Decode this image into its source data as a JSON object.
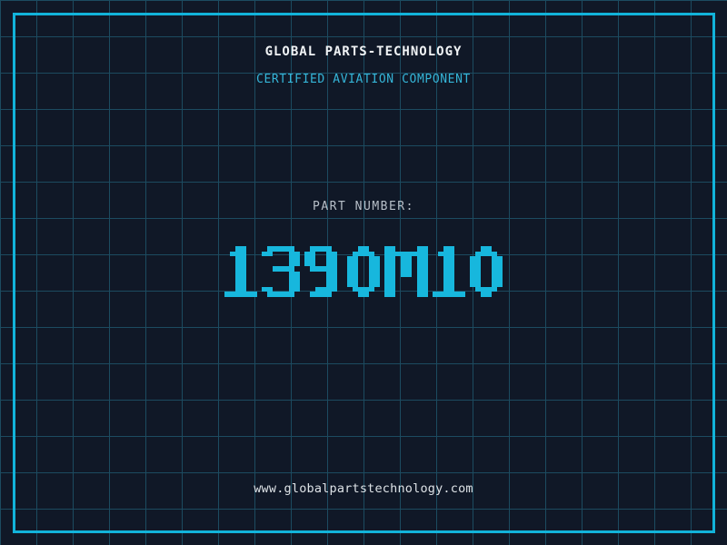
{
  "header": {
    "title": "GLOBAL PARTS-TECHNOLOGY",
    "subtitle": "CERTIFIED AVIATION COMPONENT"
  },
  "part": {
    "label": "PART NUMBER:",
    "number": "139OM1O"
  },
  "footer": {
    "url": "www.globalpartstechnology.com"
  },
  "colors": {
    "background": "#101827",
    "grid_line": "#1c4b60",
    "frame": "#12b3da",
    "title": "#f0f3f5",
    "subtitle": "#35b5d8",
    "label": "#b7bfc8",
    "part_number": "#17b7dd",
    "footer": "#dde2e6"
  }
}
